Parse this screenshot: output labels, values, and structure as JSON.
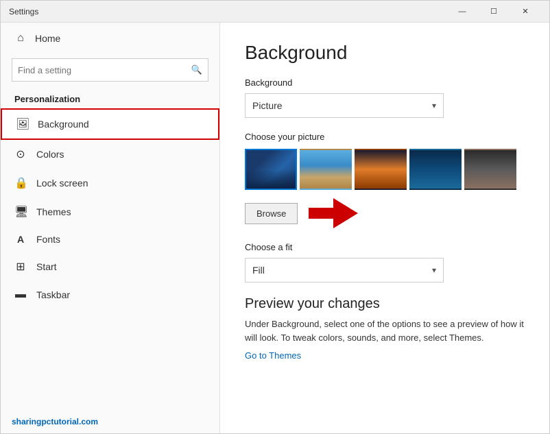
{
  "window": {
    "title": "Settings",
    "controls": {
      "minimize": "—",
      "maximize": "☐",
      "close": "✕"
    }
  },
  "sidebar": {
    "home_label": "Home",
    "search_placeholder": "Find a setting",
    "section_title": "Personalization",
    "items": [
      {
        "id": "background",
        "label": "Background",
        "icon": "🖼",
        "active": true
      },
      {
        "id": "colors",
        "label": "Colors",
        "icon": "🎨",
        "active": false
      },
      {
        "id": "lockscreen",
        "label": "Lock screen",
        "icon": "🔒",
        "active": false
      },
      {
        "id": "themes",
        "label": "Themes",
        "icon": "🖥",
        "active": false
      },
      {
        "id": "fonts",
        "label": "Fonts",
        "icon": "A",
        "active": false
      },
      {
        "id": "start",
        "label": "Start",
        "icon": "⊞",
        "active": false
      },
      {
        "id": "taskbar",
        "label": "Taskbar",
        "icon": "📋",
        "active": false
      }
    ],
    "footer_text": "sharingpctutorial.com"
  },
  "main": {
    "page_title": "Background",
    "background_label": "Background",
    "background_dropdown_value": "Picture",
    "choose_picture_label": "Choose your picture",
    "browse_label": "Browse",
    "choose_fit_label": "Choose a fit",
    "fit_dropdown_value": "Fill",
    "preview_title": "Preview your changes",
    "preview_text": "Under Background, select one of the options to see a preview of how it will look. To tweak colors, sounds, and more, select Themes.",
    "go_to_themes_label": "Go to Themes"
  }
}
